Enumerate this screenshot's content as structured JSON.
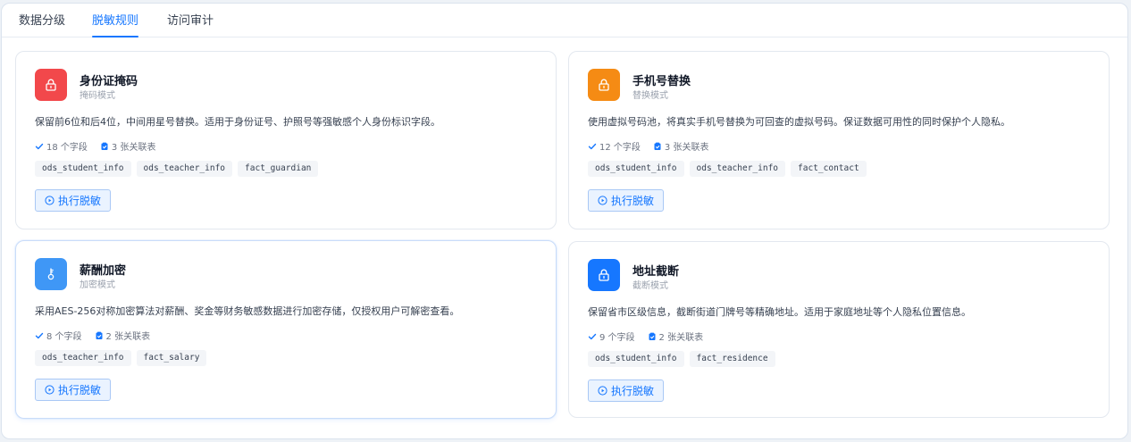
{
  "tabs": [
    {
      "label": "数据分级",
      "active": false
    },
    {
      "label": "脱敏规则",
      "active": true
    },
    {
      "label": "访问审计",
      "active": false
    }
  ],
  "cards": [
    {
      "title": "身份证掩码",
      "mode": "掩码模式",
      "icon": "lock-icon",
      "color": "#f2484b",
      "description": "保留前6位和后4位，中间用星号替换。适用于身份证号、护照号等强敏感个人身份标识字段。",
      "fields": "18 个字段",
      "tables": "3 张关联表",
      "tags": [
        "ods_student_info",
        "ods_teacher_info",
        "fact_guardian"
      ],
      "button": "执行脱敏"
    },
    {
      "title": "手机号替换",
      "mode": "替换模式",
      "icon": "lock-icon",
      "color": "#f58b14",
      "description": "使用虚拟号码池，将真实手机号替换为可回查的虚拟号码。保证数据可用性的同时保护个人隐私。",
      "fields": "12 个字段",
      "tables": "3 张关联表",
      "tags": [
        "ods_student_info",
        "ods_teacher_info",
        "fact_contact"
      ],
      "button": "执行脱敏"
    },
    {
      "title": "薪酬加密",
      "mode": "加密模式",
      "icon": "key-icon",
      "color": "#3f97f6",
      "description": "采用AES-256对称加密算法对薪酬、奖金等财务敏感数据进行加密存储，仅授权用户可解密查看。",
      "fields": "8 个字段",
      "tables": "2 张关联表",
      "tags": [
        "ods_teacher_info",
        "fact_salary"
      ],
      "button": "执行脱敏"
    },
    {
      "title": "地址截断",
      "mode": "截断模式",
      "icon": "lock-icon",
      "color": "#1677ff",
      "description": "保留省市区级信息，截断街道门牌号等精确地址。适用于家庭地址等个人隐私位置信息。",
      "fields": "9 个字段",
      "tables": "2 张关联表",
      "tags": [
        "ods_student_info",
        "fact_residence"
      ],
      "button": "执行脱敏"
    }
  ],
  "colors": {
    "accent": "#1677ff",
    "check": "#1677ff"
  }
}
